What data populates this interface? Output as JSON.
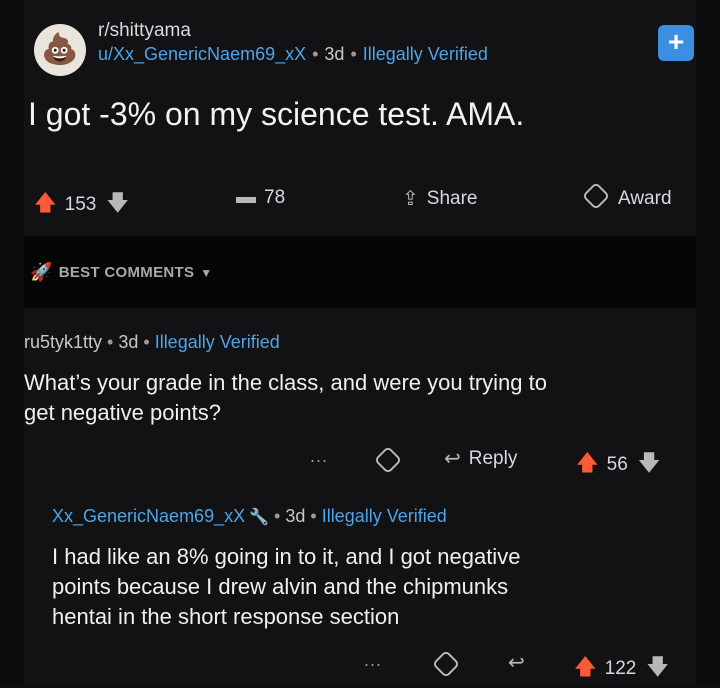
{
  "post": {
    "subreddit": "r/shittyama",
    "author": "u/Xx_GenericNaem69_xX",
    "time": "3d",
    "flair": "Illegally Verified",
    "title": "I got -3% on my science test. AMA.",
    "upvotes": "153",
    "comments": "78",
    "share_label": "Share",
    "award_label": "Award",
    "join_label": "+"
  },
  "sort": {
    "label": "BEST COMMENTS"
  },
  "comments": [
    {
      "author": "ru5tyk1tty",
      "time": "3d",
      "flair": "Illegally Verified",
      "body_line1": "What’s your grade in the class, and were you trying to",
      "body_line2": "get negative points?",
      "more": "...",
      "reply_label": "Reply",
      "score": "56"
    },
    {
      "author": "Xx_GenericNaem69_xX",
      "time": "3d",
      "flair": "Illegally Verified",
      "body_line1": "I had like an 8% going in to it, and I got negative",
      "body_line2": "points because I drew alvin and the chipmunks",
      "body_line3": "hentai in the short response section",
      "more": "...",
      "score": "122"
    }
  ],
  "colors": {
    "upvote": "#ff5a36",
    "link_blue": "#4fa3e8",
    "join_button": "#3c8fe0"
  }
}
